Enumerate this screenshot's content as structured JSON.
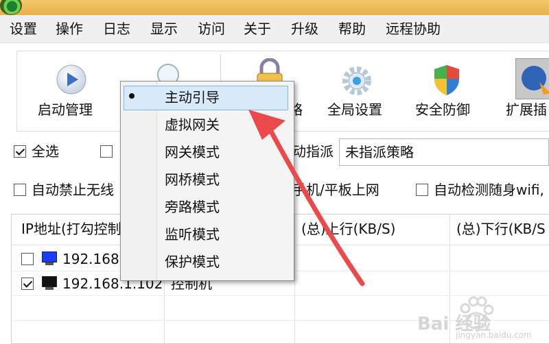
{
  "menubar": {
    "items": [
      "设置",
      "操作",
      "日志",
      "显示",
      "访问",
      "关于",
      "升级",
      "帮助",
      "远程协助"
    ]
  },
  "toolbar": {
    "items": [
      {
        "label": "启动管理",
        "icon": "play-icon"
      },
      {
        "label": "",
        "icon": "search-icon"
      },
      {
        "label": "略",
        "icon": "lock-icon"
      },
      {
        "label": "全局设置",
        "icon": "gear-icon"
      },
      {
        "label": "安全防御",
        "icon": "shield-icon"
      },
      {
        "label": "扩展插",
        "icon": "plugin-icon"
      }
    ]
  },
  "options": {
    "select_all": {
      "label": "全选",
      "checked": true
    },
    "assign_label": "动指派",
    "policy_value": "未指派策略",
    "auto_block_wireless": "自动禁止无线",
    "phone_tablet": "手机/平板上网",
    "auto_detect_wifi": "自动检测随身wifi,"
  },
  "table": {
    "headers": [
      "IP地址(打勾控制",
      "(总)上行(KB/S)",
      "(总)下行(KB/S"
    ],
    "rows": [
      {
        "ip": "192.168.",
        "note": "",
        "checked": false,
        "monitor": "blue"
      },
      {
        "ip": "192.168.1.102",
        "note": "控制机",
        "checked": true,
        "monitor": "black"
      }
    ]
  },
  "popup": {
    "items": [
      "主动引导",
      "虚拟网关",
      "网关模式",
      "网桥模式",
      "旁路模式",
      "监听模式",
      "保护模式"
    ],
    "selected_index": 0
  },
  "watermark": {
    "brand": "Bai 经验",
    "url": "jingyan.baidu.com"
  },
  "colors": {
    "titlebar": "#e7b14a",
    "highlight": "#d8eaf9",
    "arrow": "#ec4a4a"
  }
}
